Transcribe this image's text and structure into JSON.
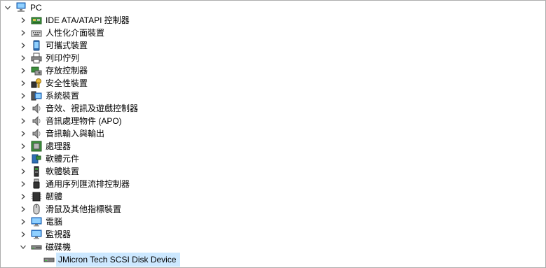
{
  "root": {
    "label": "PC",
    "expanded": true,
    "icon": "computer-icon"
  },
  "categories": [
    {
      "label": "IDE ATA/ATAPI 控制器",
      "icon": "ide-controller-icon",
      "expanded": false
    },
    {
      "label": "人性化介面裝置",
      "icon": "hid-keyboard-icon",
      "expanded": false
    },
    {
      "label": "可攜式裝置",
      "icon": "portable-device-icon",
      "expanded": false
    },
    {
      "label": "列印佇列",
      "icon": "printer-icon",
      "expanded": false
    },
    {
      "label": "存放控制器",
      "icon": "storage-controller-icon",
      "expanded": false
    },
    {
      "label": "安全性裝置",
      "icon": "security-device-icon",
      "expanded": false
    },
    {
      "label": "系統裝置",
      "icon": "system-device-icon",
      "expanded": false
    },
    {
      "label": "音效、視訊及遊戲控制器",
      "icon": "speaker-icon",
      "expanded": false
    },
    {
      "label": "音訊處理物件 (APO)",
      "icon": "speaker-icon",
      "expanded": false
    },
    {
      "label": "音訊輸入與輸出",
      "icon": "speaker-icon",
      "expanded": false
    },
    {
      "label": "處理器",
      "icon": "processor-icon",
      "expanded": false
    },
    {
      "label": "軟體元件",
      "icon": "software-component-icon",
      "expanded": false
    },
    {
      "label": "軟體裝置",
      "icon": "software-device-icon",
      "expanded": false
    },
    {
      "label": "通用序列匯流排控制器",
      "icon": "usb-icon",
      "expanded": false
    },
    {
      "label": "韌體",
      "icon": "firmware-icon",
      "expanded": false
    },
    {
      "label": "滑鼠及其他指標裝置",
      "icon": "mouse-icon",
      "expanded": false
    },
    {
      "label": "電腦",
      "icon": "monitor-icon",
      "expanded": false
    },
    {
      "label": "監視器",
      "icon": "monitor-icon",
      "expanded": false
    },
    {
      "label": "磁碟機",
      "icon": "disk-drive-icon",
      "expanded": true
    }
  ],
  "disk_children": [
    {
      "label": "JMicron Tech SCSI Disk Device",
      "icon": "disk-drive-icon",
      "selected": true
    }
  ],
  "colors": {
    "selection": "#cce8ff",
    "border": "#adadad",
    "chevron": "#404040"
  }
}
